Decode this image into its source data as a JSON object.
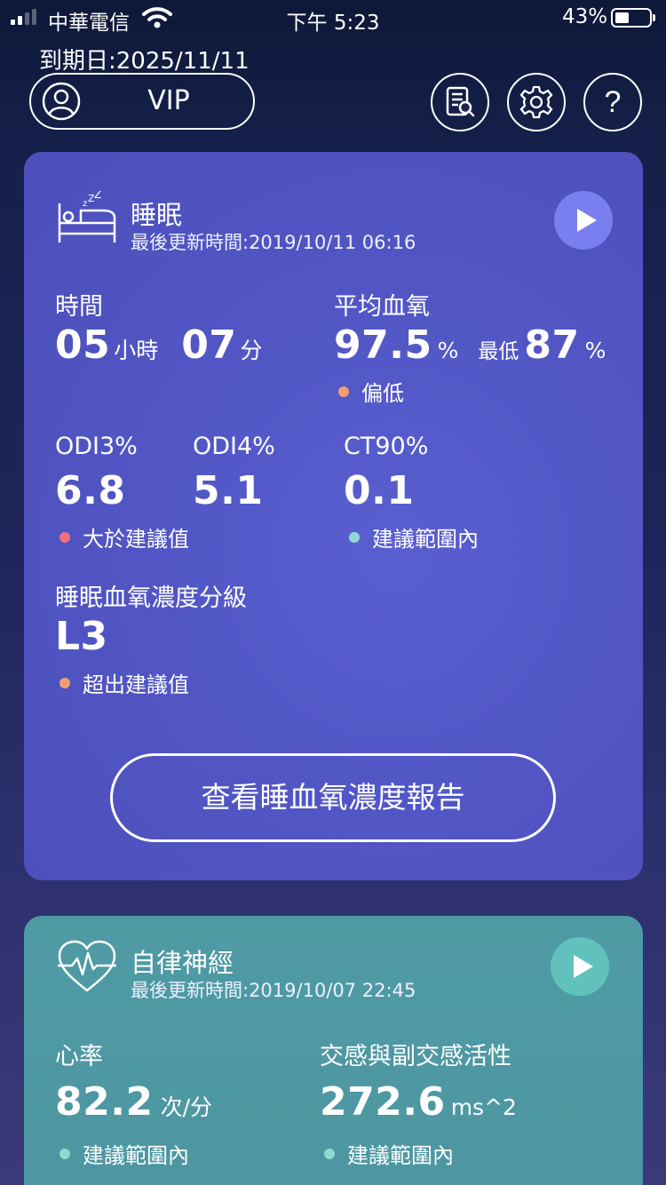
{
  "status_bar": {
    "carrier": "中華電信",
    "time": "下午 5:23",
    "battery": "43%",
    "battery_level": 0.43
  },
  "header": {
    "expiry": "到期日:2025/11/11",
    "vip_label": "VIP",
    "icons": [
      "report-icon",
      "gear-icon",
      "help-icon"
    ]
  },
  "sleep_card": {
    "title": "睡眠",
    "updated": "最後更新時間:2019/10/11 06:16",
    "duration": {
      "label": "時間",
      "hours": "05",
      "hours_unit": "小時",
      "minutes": "07",
      "minutes_unit": "分"
    },
    "spo2": {
      "label": "平均血氧",
      "avg": "97.5",
      "avg_unit": "%",
      "min_label": "最低",
      "min": "87",
      "min_unit": "%",
      "status": "偏低"
    },
    "odi3": {
      "label": "ODI3%",
      "value": "6.8"
    },
    "odi4": {
      "label": "ODI4%",
      "value": "5.1"
    },
    "odi_status": "大於建議值",
    "ct90": {
      "label": "CT90%",
      "value": "0.1",
      "status": "建議範圍內"
    },
    "grade": {
      "label": "睡眠血氧濃度分級",
      "value": "L3",
      "status": "超出建議值"
    },
    "report_button": "查看睡血氧濃度報告"
  },
  "ans_card": {
    "title": "自律神經",
    "updated": "最後更新時間:2019/10/07 22:45",
    "heart_rate": {
      "label": "心率",
      "value": "82.2",
      "unit": "次/分",
      "status": "建議範圍內"
    },
    "activity": {
      "label": "交感與副交感活性",
      "value": "272.6",
      "unit": "ms^2",
      "status": "建議範圍內"
    }
  },
  "colors": {
    "sleep_card_bg": "#5257c6",
    "sleep_play": "#7a7ff0",
    "ans_card_bg": "#4f9ba4",
    "ans_play": "#61c2bd",
    "dot_orange": "#f0a070",
    "dot_red": "#f07080",
    "dot_teal": "#90d8d0"
  }
}
